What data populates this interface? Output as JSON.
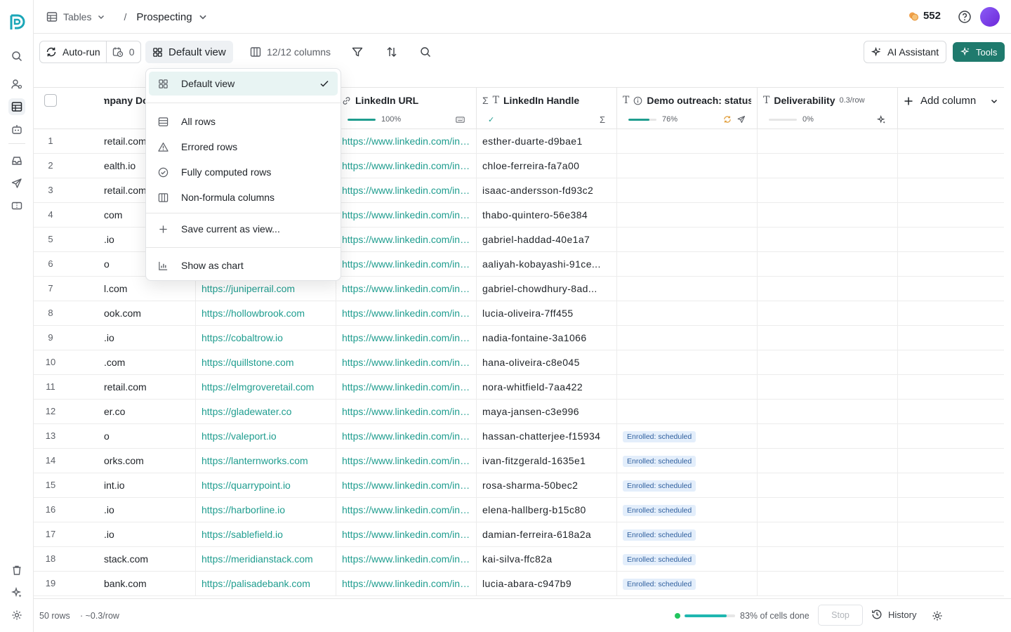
{
  "breadcrumb": {
    "tables": "Tables",
    "separator": "/",
    "current": "Prospecting"
  },
  "credits": "552",
  "toolbar": {
    "autorun": "Auto-run",
    "schedule_count": "0",
    "view": "Default view",
    "columns": "12/12 columns",
    "ai_assistant": "AI Assistant",
    "tools": "Tools"
  },
  "columns": {
    "company": {
      "label": "mpany Do",
      "stat": "%"
    },
    "linkedin_url": {
      "label": "LinkedIn URL",
      "stat": "100%",
      "progress": 100
    },
    "linkedin_handle": {
      "label": "LinkedIn Handle"
    },
    "demo": {
      "label": "Demo outreach: status",
      "stat": "76%",
      "progress": 76
    },
    "deliverability": {
      "label": "Deliverability",
      "rate": "0.3/row",
      "stat": "0%",
      "progress": 0
    },
    "add": "Add column"
  },
  "rows": [
    {
      "n": "1",
      "company": "retail.com",
      "website": "",
      "url": "https://www.linkedin.com/in/esther-duarte",
      "handle": "esther-duarte-d9bae1",
      "status": ""
    },
    {
      "n": "2",
      "company": "ealth.io",
      "website": "",
      "url": "https://www.linkedin.com/in/chloe-ferreira",
      "handle": "chloe-ferreira-fa7a00",
      "status": ""
    },
    {
      "n": "3",
      "company": "retail.com",
      "website": "",
      "url": "https://www.linkedin.com/in/isaac-andersson",
      "handle": "isaac-andersson-fd93c2",
      "status": ""
    },
    {
      "n": "4",
      "company": "com",
      "website": "",
      "url": "https://www.linkedin.com/in/thabo-quintero",
      "handle": "thabo-quintero-56e384",
      "status": ""
    },
    {
      "n": "5",
      "company": ".io",
      "website": "",
      "url": "https://www.linkedin.com/in/gabriel-haddad",
      "handle": "gabriel-haddad-40e1a7",
      "status": ""
    },
    {
      "n": "6",
      "company": "o",
      "website": "",
      "url": "https://www.linkedin.com/in/aaliyah-kobayashi",
      "handle": "aaliyah-kobayashi-91ce...",
      "status": ""
    },
    {
      "n": "7",
      "company": "l.com",
      "website": "https://juniperrail.com",
      "url": "https://www.linkedin.com/in/gabriel-chowdhury",
      "handle": "gabriel-chowdhury-8ad...",
      "status": ""
    },
    {
      "n": "8",
      "company": "ook.com",
      "website": "https://hollowbrook.com",
      "url": "https://www.linkedin.com/in/lucia-oliveira",
      "handle": "lucia-oliveira-7ff455",
      "status": ""
    },
    {
      "n": "9",
      "company": ".io",
      "website": "https://cobaltrow.io",
      "url": "https://www.linkedin.com/in/nadia-fontaine",
      "handle": "nadia-fontaine-3a1066",
      "status": ""
    },
    {
      "n": "10",
      "company": ".com",
      "website": "https://quillstone.com",
      "url": "https://www.linkedin.com/in/hana-oliveira",
      "handle": "hana-oliveira-c8e045",
      "status": ""
    },
    {
      "n": "11",
      "company": "retail.com",
      "website": "https://elmgroveretail.com",
      "url": "https://www.linkedin.com/in/nora-whitfield",
      "handle": "nora-whitfield-7aa422",
      "status": ""
    },
    {
      "n": "12",
      "company": "er.co",
      "website": "https://gladewater.co",
      "url": "https://www.linkedin.com/in/maya-jansen",
      "handle": "maya-jansen-c3e996",
      "status": ""
    },
    {
      "n": "13",
      "company": "o",
      "website": "https://valeport.io",
      "url": "https://www.linkedin.com/in/hassan-chatterjee",
      "handle": "hassan-chatterjee-f15934",
      "status": "Enrolled: scheduled"
    },
    {
      "n": "14",
      "company": "orks.com",
      "website": "https://lanternworks.com",
      "url": "https://www.linkedin.com/in/ivan-fitzgerald",
      "handle": "ivan-fitzgerald-1635e1",
      "status": "Enrolled: scheduled"
    },
    {
      "n": "15",
      "company": "int.io",
      "website": "https://quarrypoint.io",
      "url": "https://www.linkedin.com/in/rosa-sharma",
      "handle": "rosa-sharma-50bec2",
      "status": "Enrolled: scheduled"
    },
    {
      "n": "16",
      "company": ".io",
      "website": "https://harborline.io",
      "url": "https://www.linkedin.com/in/elena-hallberg",
      "handle": "elena-hallberg-b15c80",
      "status": "Enrolled: scheduled"
    },
    {
      "n": "17",
      "company": ".io",
      "website": "https://sablefield.io",
      "url": "https://www.linkedin.com/in/damian-ferreira",
      "handle": "damian-ferreira-618a2a",
      "status": "Enrolled: scheduled"
    },
    {
      "n": "18",
      "company": "stack.com",
      "website": "https://meridianstack.com",
      "url": "https://www.linkedin.com/in/kai-silva",
      "handle": "kai-silva-ffc82a",
      "status": "Enrolled: scheduled"
    },
    {
      "n": "19",
      "company": "bank.com",
      "website": "https://palisadebank.com",
      "url": "https://www.linkedin.com/in/lucia-abara",
      "handle": "lucia-abara-c947b9",
      "status": "Enrolled: scheduled"
    }
  ],
  "menu": {
    "default_view": "Default view",
    "all_rows": "All rows",
    "errored_rows": "Errored rows",
    "fully_computed": "Fully computed rows",
    "non_formula": "Non-formula columns",
    "save_view": "Save current as view...",
    "show_chart": "Show as chart"
  },
  "footer": {
    "rows": "50 rows",
    "rate": "· ~0.3/row",
    "progress": 83,
    "done": "83% of cells done",
    "stop": "Stop",
    "history": "History"
  },
  "colors": {
    "accent": "#1f9d8f",
    "tools": "#1f7a6d",
    "badge_bg": "#e3eefb",
    "badge_text": "#2f5f9e"
  }
}
